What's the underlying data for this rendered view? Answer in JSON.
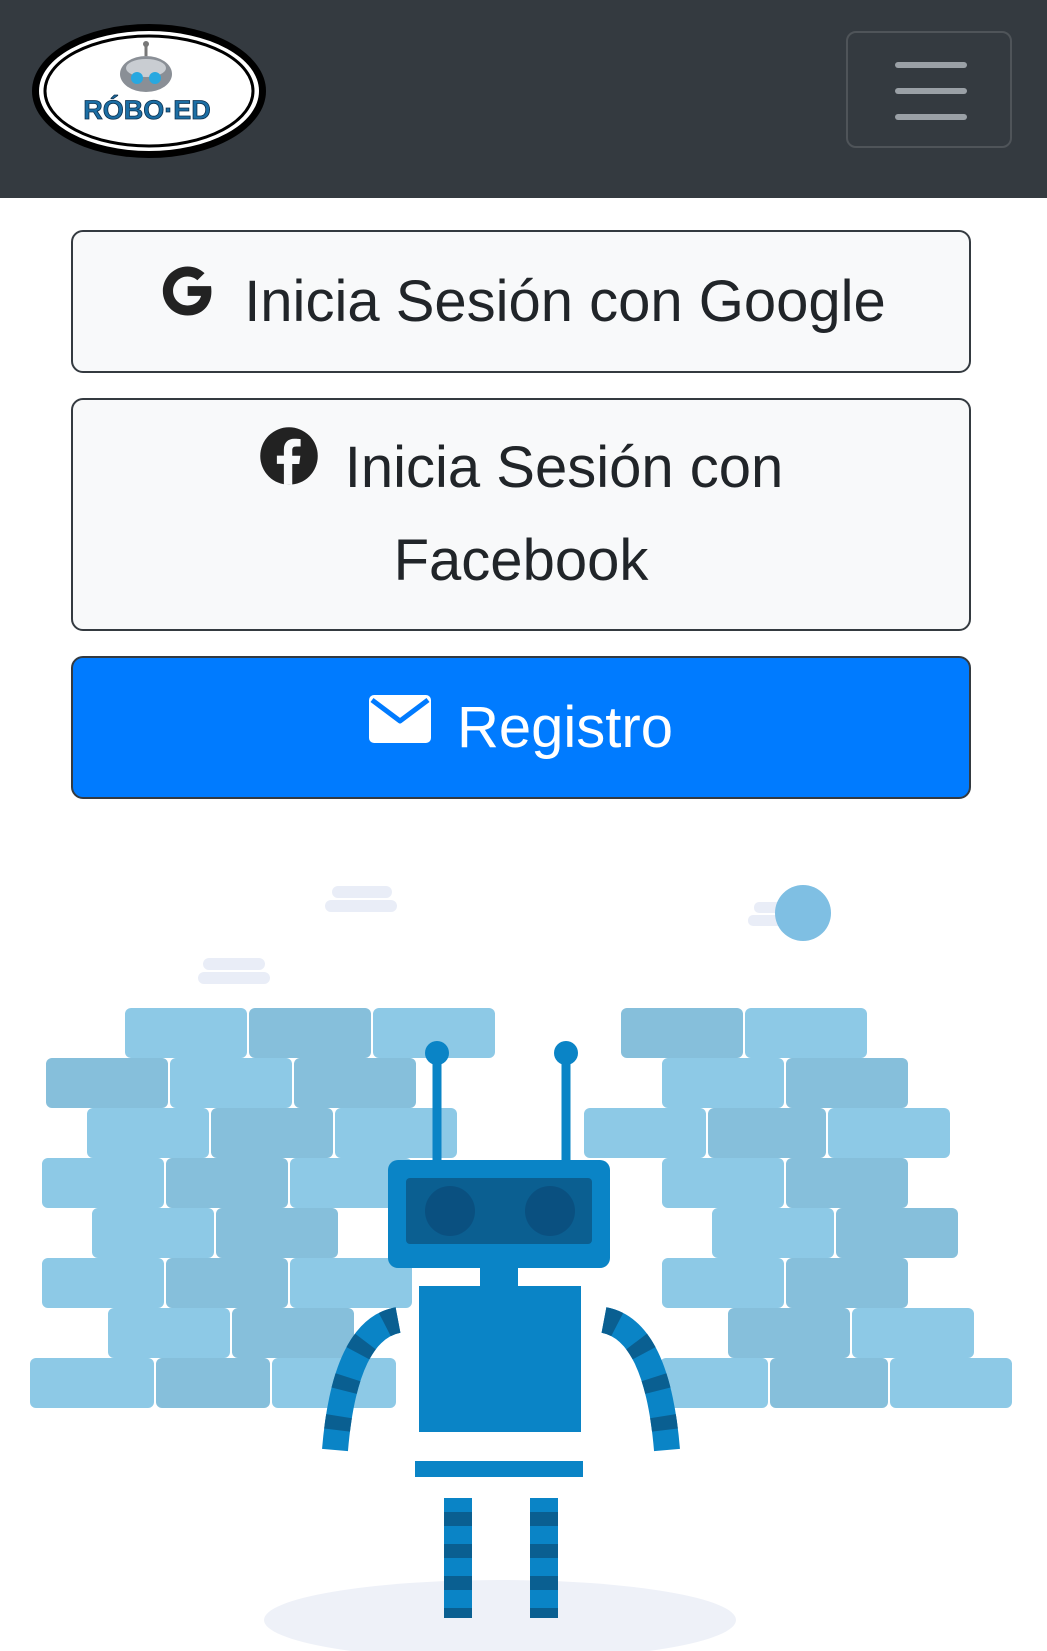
{
  "brand": {
    "logo_text": "RÓBO·ED"
  },
  "navbar": {
    "menu_icon": "hamburger-icon"
  },
  "buttons": {
    "google": {
      "label": "Inicia Sesión con Google",
      "icon": "google-icon"
    },
    "facebook": {
      "label_line1": "Inicia Sesión con",
      "label_line2": "Facebook",
      "icon": "facebook-icon"
    },
    "register": {
      "label": "Registro",
      "icon": "envelope-icon"
    }
  },
  "colors": {
    "navbar_bg": "#343a40",
    "primary": "#007bff",
    "light_bg": "#f8f9fa",
    "brick_light": "#8ecae6",
    "robot_blue": "#0a84c6"
  }
}
